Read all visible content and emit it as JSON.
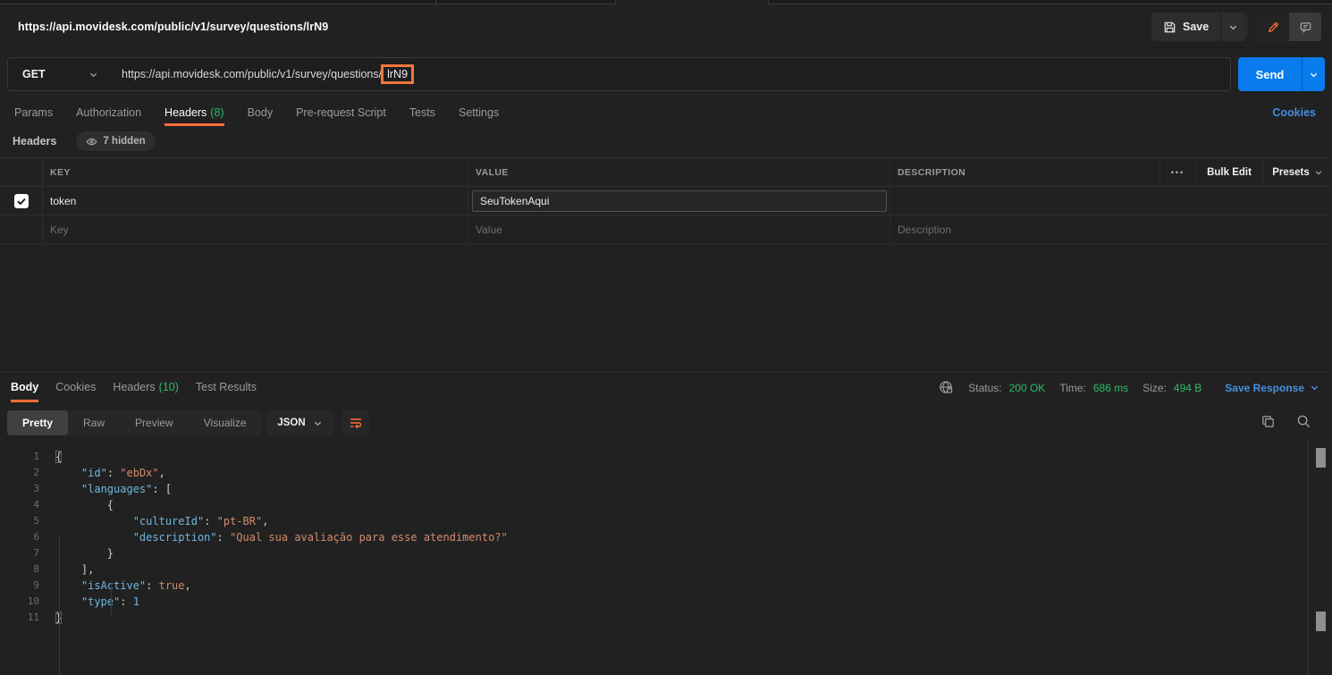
{
  "header": {
    "request_title": "https://api.movidesk.com/public/v1/survey/questions/lrN9",
    "save_label": "Save"
  },
  "request": {
    "method": "GET",
    "url_prefix": "https://api.movidesk.com/public/v1/survey/questions/",
    "url_highlight": "lrN9",
    "send_label": "Send",
    "tabs": {
      "params": "Params",
      "authorization": "Authorization",
      "headers": "Headers",
      "headers_count": "(8)",
      "body": "Body",
      "prerequest": "Pre-request Script",
      "tests": "Tests",
      "settings": "Settings"
    },
    "cookies_link": "Cookies"
  },
  "headers_editor": {
    "title": "Headers",
    "hidden_badge": "7 hidden",
    "columns": {
      "key": "KEY",
      "value": "VALUE",
      "description": "DESCRIPTION"
    },
    "more_options": "•••",
    "bulk_edit": "Bulk Edit",
    "presets": "Presets",
    "rows": [
      {
        "key": "token",
        "value": "SeuTokenAqui",
        "description": ""
      }
    ],
    "placeholder_row": {
      "key": "Key",
      "value": "Value",
      "description": "Description"
    }
  },
  "response": {
    "tabs": {
      "body": "Body",
      "cookies": "Cookies",
      "headers": "Headers",
      "headers_count": "(10)",
      "test_results": "Test Results"
    },
    "meta": {
      "status_label": "Status:",
      "status_value": "200 OK",
      "time_label": "Time:",
      "time_value": "686 ms",
      "size_label": "Size:",
      "size_value": "494 B",
      "save_response": "Save Response"
    },
    "view_tabs": {
      "pretty": "Pretty",
      "raw": "Raw",
      "preview": "Preview",
      "visualize": "Visualize"
    },
    "format": "JSON",
    "code": {
      "lines": [
        {
          "n": "1",
          "s": [
            {
              "c": "brace",
              "t": "{"
            }
          ]
        },
        {
          "n": "2",
          "s": [
            {
              "c": "punct",
              "t": "    "
            },
            {
              "c": "key",
              "t": "\"id\""
            },
            {
              "c": "punct",
              "t": ": "
            },
            {
              "c": "str",
              "t": "\"ebDx\""
            },
            {
              "c": "punct",
              "t": ","
            }
          ]
        },
        {
          "n": "3",
          "s": [
            {
              "c": "punct",
              "t": "    "
            },
            {
              "c": "key",
              "t": "\"languages\""
            },
            {
              "c": "punct",
              "t": ": ["
            }
          ]
        },
        {
          "n": "4",
          "s": [
            {
              "c": "punct",
              "t": "        {"
            }
          ]
        },
        {
          "n": "5",
          "s": [
            {
              "c": "punct",
              "t": "            "
            },
            {
              "c": "key",
              "t": "\"cultureId\""
            },
            {
              "c": "punct",
              "t": ": "
            },
            {
              "c": "str",
              "t": "\"pt-BR\""
            },
            {
              "c": "punct",
              "t": ","
            }
          ]
        },
        {
          "n": "6",
          "s": [
            {
              "c": "punct",
              "t": "            "
            },
            {
              "c": "key",
              "t": "\"description\""
            },
            {
              "c": "punct",
              "t": ": "
            },
            {
              "c": "str",
              "t": "\"Qual sua avaliação para esse atendimento?\""
            }
          ]
        },
        {
          "n": "7",
          "s": [
            {
              "c": "punct",
              "t": "        }"
            }
          ]
        },
        {
          "n": "8",
          "s": [
            {
              "c": "punct",
              "t": "    ],"
            }
          ]
        },
        {
          "n": "9",
          "s": [
            {
              "c": "punct",
              "t": "    "
            },
            {
              "c": "key",
              "t": "\"isActive\""
            },
            {
              "c": "punct",
              "t": ": "
            },
            {
              "c": "bool",
              "t": "true"
            },
            {
              "c": "punct",
              "t": ","
            }
          ]
        },
        {
          "n": "10",
          "s": [
            {
              "c": "punct",
              "t": "    "
            },
            {
              "c": "key",
              "t": "\"type\""
            },
            {
              "c": "punct",
              "t": ": "
            },
            {
              "c": "num",
              "t": "1"
            }
          ]
        },
        {
          "n": "11",
          "s": [
            {
              "c": "brace",
              "t": "}"
            }
          ]
        }
      ]
    }
  },
  "colors": {
    "accent_orange": "#ff6c37",
    "status_green": "#2ebd6b",
    "link_blue": "#478fe1",
    "send_blue": "#097bed"
  }
}
